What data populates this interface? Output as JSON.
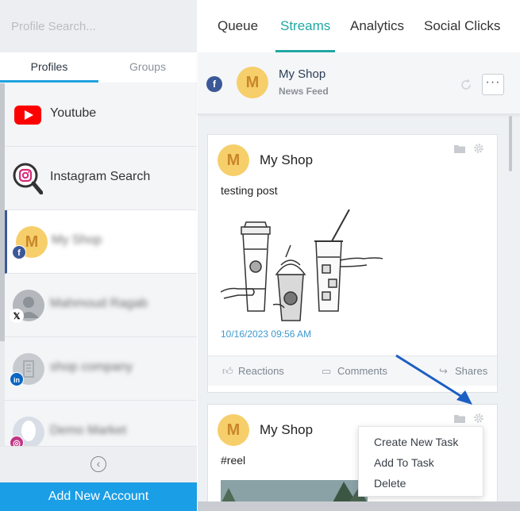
{
  "sidebar": {
    "search_placeholder": "Profile Search...",
    "tabs": [
      {
        "label": "Profiles"
      },
      {
        "label": "Groups"
      }
    ],
    "profiles": [
      {
        "name": "Youtube",
        "icon": "youtube-icon"
      },
      {
        "name": "Instagram Search",
        "icon": "instagram-search-icon"
      },
      {
        "name": "My Shop",
        "avatar_letter": "M",
        "network": "facebook"
      },
      {
        "name": "Mahmoud Ragab",
        "network": "x"
      },
      {
        "name": "shop company",
        "network": "linkedin"
      },
      {
        "name": "Demo Market",
        "network": "instagram"
      }
    ],
    "add_account_label": "Add New Account"
  },
  "main": {
    "tabs": [
      {
        "label": "Queue"
      },
      {
        "label": "Streams"
      },
      {
        "label": "Analytics"
      },
      {
        "label": "Social Clicks"
      }
    ],
    "stream": {
      "name": "My Shop",
      "subtitle": "News Feed",
      "avatar_letter": "M"
    },
    "posts": [
      {
        "author": "My Shop",
        "avatar_letter": "M",
        "text": "testing post",
        "date": "10/16/2023 09:56 AM",
        "actions": [
          "Reactions",
          "Comments",
          "Shares"
        ]
      },
      {
        "author": "My Shop",
        "avatar_letter": "M",
        "text": "#reel"
      }
    ],
    "menu": [
      "Create New Task",
      "Add To Task",
      "Delete"
    ]
  },
  "colors": {
    "accent": "#20a8a3",
    "add_button": "#1a9ee6",
    "facebook": "#3b5998",
    "arrow": "#1c5fc4"
  }
}
